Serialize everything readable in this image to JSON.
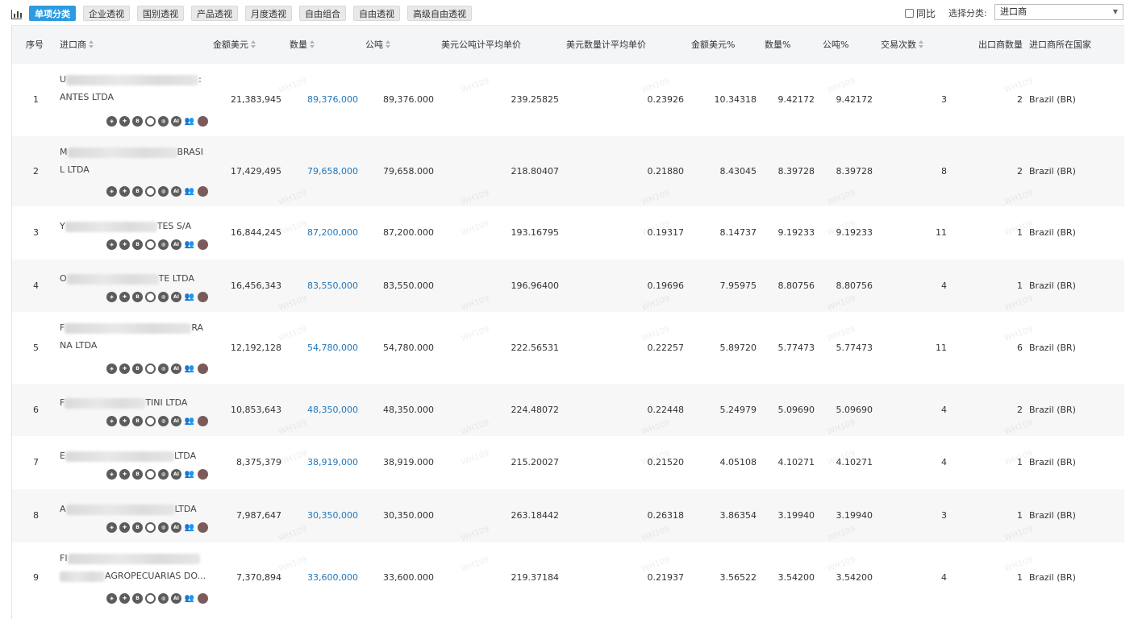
{
  "toolbar": {
    "tabs": [
      {
        "label": "单项分类",
        "active": true
      },
      {
        "label": "企业透视",
        "active": false
      },
      {
        "label": "国别透视",
        "active": false
      },
      {
        "label": "产品透视",
        "active": false
      },
      {
        "label": "月度透视",
        "active": false
      },
      {
        "label": "自由组合",
        "active": false
      },
      {
        "label": "自由透视",
        "active": false
      },
      {
        "label": "高级自由透视",
        "active": false
      }
    ],
    "yoy_label": "同比",
    "select_label": "选择分类:",
    "select_value": "进口商"
  },
  "columns": [
    "序号",
    "进口商",
    "金额美元",
    "数量",
    "公吨",
    "美元公吨计平均单价",
    "美元数量计平均单价",
    "金额美元%",
    "数量%",
    "公吨%",
    "交易次数",
    "出口商数量",
    "进口商所在国家"
  ],
  "watermark": "WH109",
  "accent_color": "#2e9be0",
  "link_color": "#2277bb",
  "row_icons": [
    "location-icon",
    "plus-circle-icon",
    "b-badge-icon",
    "circle-icon",
    "globe-icon",
    "ai-icon",
    "people-icon",
    "record-icon"
  ],
  "rows": [
    {
      "no": "1",
      "name_lines": [
        {
          "prefix": "U",
          "suffix": ":"
        },
        {
          "prefix": "ANTES LTDA",
          "suffix": ""
        }
      ],
      "amount": "21,383,945",
      "qty": "89,376,000",
      "tons": "89,376.000",
      "usd_ton": "239.25825",
      "usd_qty": "0.23926",
      "amount_pct": "10.34318",
      "qty_pct": "9.42172",
      "ton_pct": "9.42172",
      "trades": "3",
      "exporters": "2",
      "country": "Brazil (BR)"
    },
    {
      "no": "2",
      "name_lines": [
        {
          "prefix": "M",
          "suffix": "BRASI"
        },
        {
          "prefix": "L LTDA",
          "suffix": ""
        }
      ],
      "amount": "17,429,495",
      "qty": "79,658,000",
      "tons": "79,658.000",
      "usd_ton": "218.80407",
      "usd_qty": "0.21880",
      "amount_pct": "8.43045",
      "qty_pct": "8.39728",
      "ton_pct": "8.39728",
      "trades": "8",
      "exporters": "2",
      "country": "Brazil (BR)"
    },
    {
      "no": "3",
      "name_lines": [
        {
          "prefix": "Y",
          "suffix": "TES S/A"
        }
      ],
      "amount": "16,844,245",
      "qty": "87,200,000",
      "tons": "87,200.000",
      "usd_ton": "193.16795",
      "usd_qty": "0.19317",
      "amount_pct": "8.14737",
      "qty_pct": "9.19233",
      "ton_pct": "9.19233",
      "trades": "11",
      "exporters": "1",
      "country": "Brazil (BR)"
    },
    {
      "no": "4",
      "name_lines": [
        {
          "prefix": "O",
          "suffix": "TE LTDA"
        }
      ],
      "amount": "16,456,343",
      "qty": "83,550,000",
      "tons": "83,550.000",
      "usd_ton": "196.96400",
      "usd_qty": "0.19696",
      "amount_pct": "7.95975",
      "qty_pct": "8.80756",
      "ton_pct": "8.80756",
      "trades": "4",
      "exporters": "1",
      "country": "Brazil (BR)"
    },
    {
      "no": "5",
      "name_lines": [
        {
          "prefix": "F",
          "suffix": "RA"
        },
        {
          "prefix": "NA LTDA",
          "suffix": ""
        }
      ],
      "amount": "12,192,128",
      "qty": "54,780,000",
      "tons": "54,780.000",
      "usd_ton": "222.56531",
      "usd_qty": "0.22257",
      "amount_pct": "5.89720",
      "qty_pct": "5.77473",
      "ton_pct": "5.77473",
      "trades": "11",
      "exporters": "6",
      "country": "Brazil (BR)"
    },
    {
      "no": "6",
      "name_lines": [
        {
          "prefix": "F",
          "suffix": "TINI LTDA"
        }
      ],
      "amount": "10,853,643",
      "qty": "48,350,000",
      "tons": "48,350.000",
      "usd_ton": "224.48072",
      "usd_qty": "0.22448",
      "amount_pct": "5.24979",
      "qty_pct": "5.09690",
      "ton_pct": "5.09690",
      "trades": "4",
      "exporters": "2",
      "country": "Brazil (BR)"
    },
    {
      "no": "7",
      "name_lines": [
        {
          "prefix": "E",
          "suffix": "LTDA"
        }
      ],
      "amount": "8,375,379",
      "qty": "38,919,000",
      "tons": "38,919.000",
      "usd_ton": "215.20027",
      "usd_qty": "0.21520",
      "amount_pct": "4.05108",
      "qty_pct": "4.10271",
      "ton_pct": "4.10271",
      "trades": "4",
      "exporters": "1",
      "country": "Brazil (BR)"
    },
    {
      "no": "8",
      "name_lines": [
        {
          "prefix": "A",
          "suffix": "LTDA"
        }
      ],
      "amount": "7,987,647",
      "qty": "30,350,000",
      "tons": "30,350.000",
      "usd_ton": "263.18442",
      "usd_qty": "0.26318",
      "amount_pct": "3.86354",
      "qty_pct": "3.19940",
      "ton_pct": "3.19940",
      "trades": "3",
      "exporters": "1",
      "country": "Brazil (BR)"
    },
    {
      "no": "9",
      "name_lines": [
        {
          "prefix": "FI",
          "suffix": ""
        },
        {
          "prefix": "",
          "suffix": "AGROPECUARIAS DO..."
        }
      ],
      "amount": "7,370,894",
      "qty": "33,600,000",
      "tons": "33,600.000",
      "usd_ton": "219.37184",
      "usd_qty": "0.21937",
      "amount_pct": "3.56522",
      "qty_pct": "3.54200",
      "ton_pct": "3.54200",
      "trades": "4",
      "exporters": "1",
      "country": "Brazil (BR)"
    }
  ]
}
